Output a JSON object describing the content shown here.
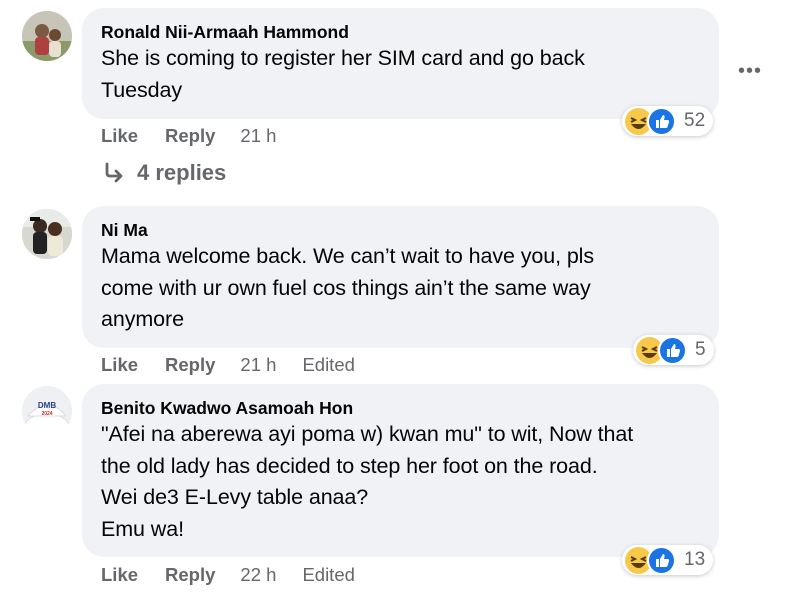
{
  "comments": [
    {
      "author": "Ronald Nii-Armaah Hammond",
      "text": "She is coming to register her SIM card and go back\nTuesday",
      "like_label": "Like",
      "reply_label": "Reply",
      "time": "21 h",
      "reaction_count": "52",
      "reaction_icons": [
        "haha-icon",
        "like-icon"
      ]
    },
    {
      "author": "Ni Ma",
      "text": "Mama welcome back. We can’t wait to have you, pls\ncome with ur own fuel cos things ain’t the same way\nanymore",
      "like_label": "Like",
      "reply_label": "Reply",
      "time": "21 h",
      "edited": "Edited",
      "reaction_count": "5",
      "reaction_icons": [
        "haha-icon",
        "like-icon"
      ]
    },
    {
      "author": "Benito Kwadwo Asamoah Hon",
      "text": "\"Afei na aberewa ayi poma w) kwan mu\" to wit, Now that\nthe old lady has decided to step her foot on the road.\nWei de3 E-Levy table anaa?\nEmu wa!",
      "like_label": "Like",
      "reply_label": "Reply",
      "time": "22 h",
      "edited": "Edited",
      "reaction_count": "13",
      "reaction_icons": [
        "haha-icon",
        "like-icon"
      ],
      "avatar_text": "DMB",
      "avatar_subtext": "2024"
    }
  ],
  "replies_link": "4 replies",
  "more_menu": "•••",
  "colors": {
    "bubble": "#f0f2f5",
    "secondary_text": "#65676b",
    "like_blue": "#1b74e4",
    "haha_yellow": "#f7c94b"
  }
}
